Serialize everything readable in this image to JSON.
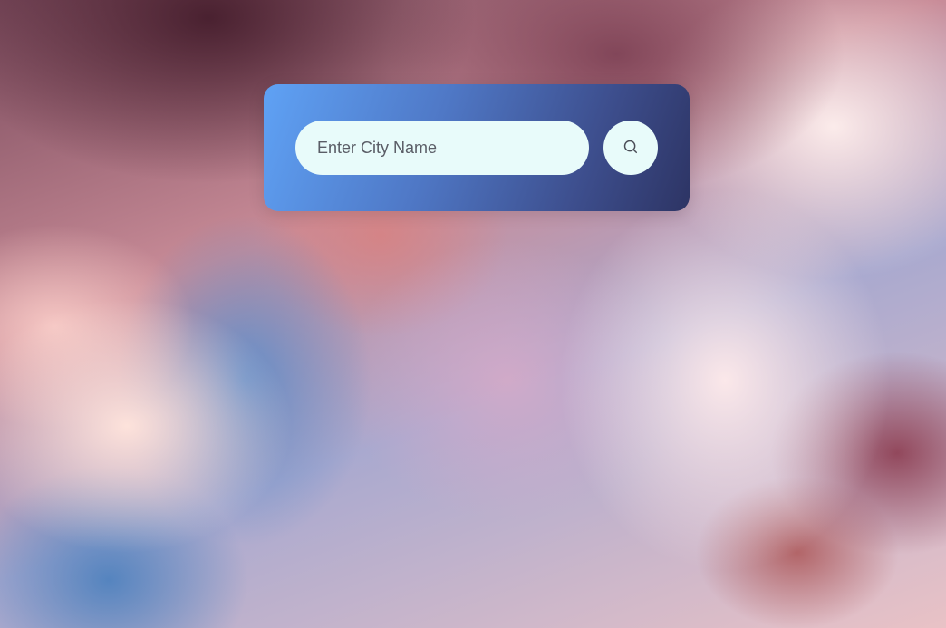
{
  "search": {
    "placeholder": "Enter City Name",
    "value": "",
    "button_icon": "search-icon"
  },
  "colors": {
    "card_gradient_start": "#5fa2f5",
    "card_gradient_end": "#2d3464",
    "field_background": "#e8fbfa"
  }
}
